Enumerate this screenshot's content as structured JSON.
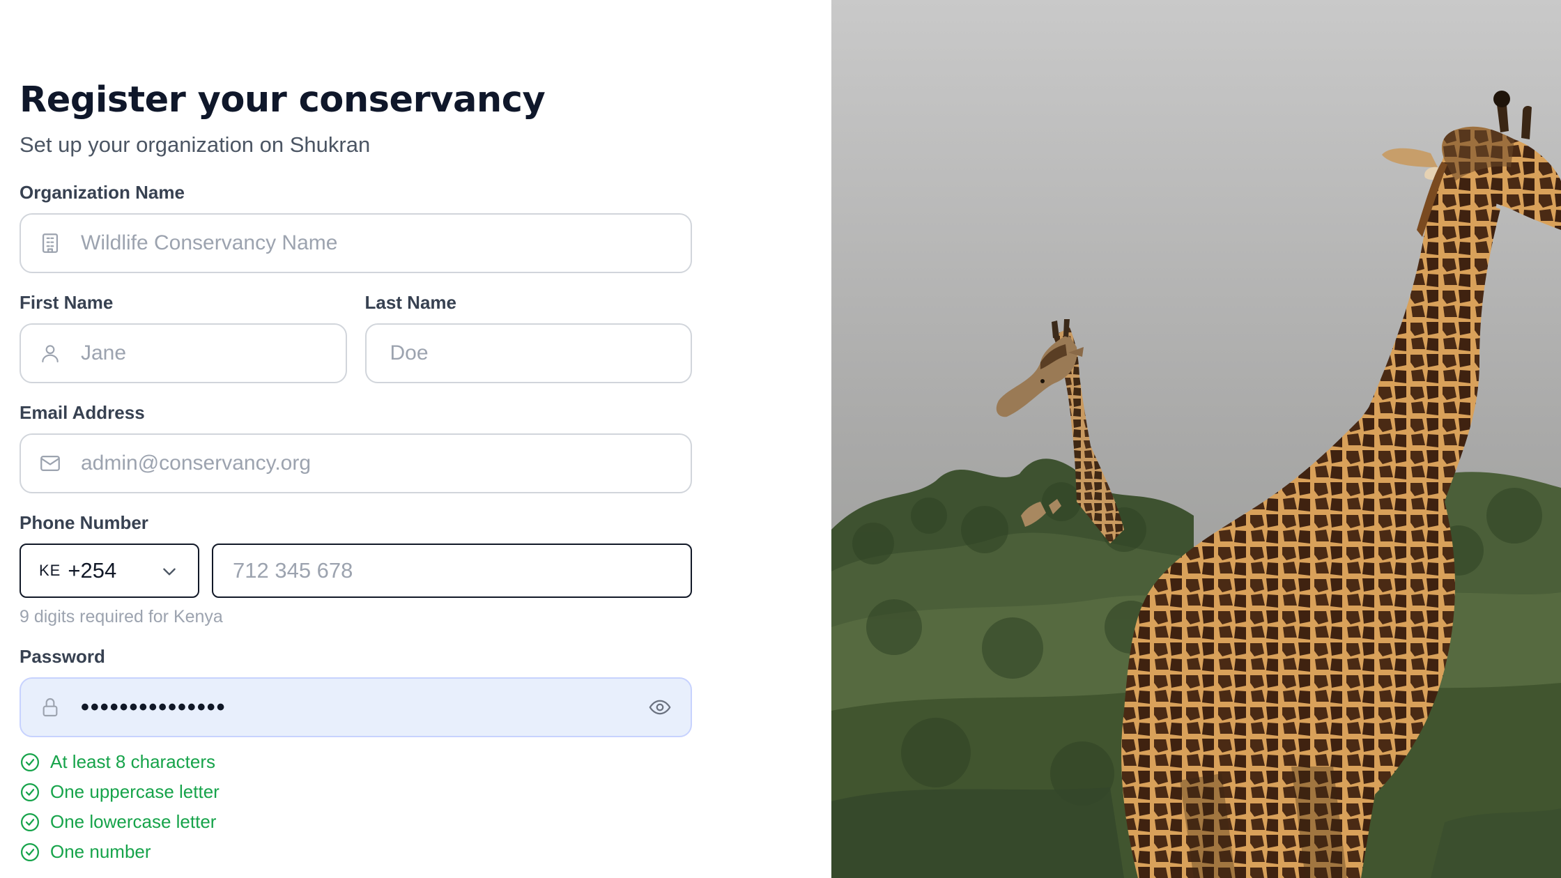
{
  "header": {
    "title": "Register your conservancy",
    "subtitle": "Set up your organization on Shukran"
  },
  "organization": {
    "label": "Organization Name",
    "placeholder": "Wildlife Conservancy Name",
    "icon": "building-icon"
  },
  "first_name": {
    "label": "First Name",
    "placeholder": "Jane",
    "icon": "user-icon"
  },
  "last_name": {
    "label": "Last Name",
    "placeholder": "Doe"
  },
  "email": {
    "label": "Email Address",
    "placeholder": "admin@conservancy.org",
    "icon": "mail-icon"
  },
  "phone": {
    "label": "Phone Number",
    "country_flag": "KE",
    "country_code": "+254",
    "placeholder": "712 345 678",
    "hint": "9 digits required for Kenya"
  },
  "password": {
    "label": "Password",
    "value": "•••••••••••••••",
    "icon": "lock-icon",
    "toggle_icon": "eye-icon",
    "requirements": [
      "At least 8 characters",
      "One uppercase letter",
      "One lowercase letter",
      "One number"
    ]
  },
  "colors": {
    "accent_success": "#16a34a",
    "password_bg": "#e8effc",
    "title": "#0f172a"
  },
  "photo": {
    "subject": "giraffes-image"
  }
}
